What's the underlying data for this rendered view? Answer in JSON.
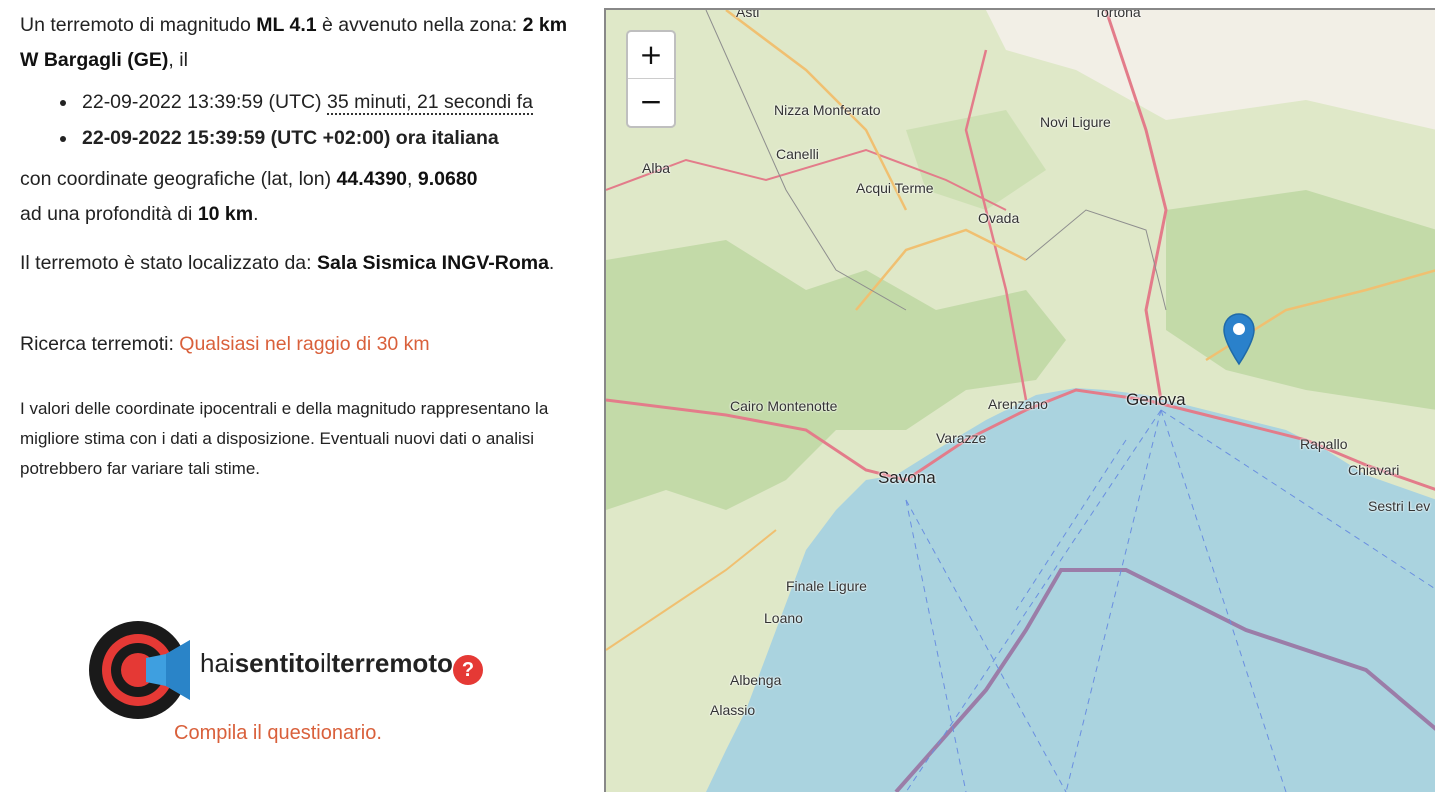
{
  "info": {
    "line1_pre": "Un terremoto di magnitudo ",
    "magnitude": "ML 4.1",
    "line1_post": " è avvenuto nella zona: ",
    "zone": "2 km W Bargagli (GE)",
    "line1_end": ", il",
    "utc_time": "22-09-2022 13:39:59 (UTC)",
    "ago": "35 minuti, 21 secondi fa",
    "local_time": "22-09-2022 15:39:59 (UTC +02:00) ora italiana",
    "coord_pre": "con coordinate geografiche (lat, lon) ",
    "lat": "44.4390",
    "coord_sep": ", ",
    "lon": "9.0680",
    "depth_pre": "ad una profondità di ",
    "depth": "10 km",
    "depth_post": ".",
    "located_pre": "Il terremoto è stato localizzato da: ",
    "located_by": "Sala Sismica INGV-Roma",
    "located_post": "."
  },
  "search": {
    "label": "Ricerca terremoti: ",
    "link": "Qualsiasi nel raggio di 30 km"
  },
  "disclaimer": "I valori delle coordinate ipocentrali e della magnitudo rappresentano la migliore stima con i dati a disposizione. Eventuali nuovi dati o analisi potrebbero far variare tali stime.",
  "survey": {
    "logo_hai": "hai",
    "logo_sentito": "sentito",
    "logo_il": "il",
    "logo_terremoto": "terremoto",
    "help_glyph": "?",
    "link": "Compila il questionario."
  },
  "map": {
    "zoom_in": "+",
    "zoom_out": "−",
    "labels": {
      "tortona": "Tortona",
      "asti": "Asti",
      "nizza": "Nizza Monferrato",
      "novi": "Novi Ligure",
      "canelli": "Canelli",
      "alba": "Alba",
      "acqui": "Acqui Terme",
      "ovada": "Ovada",
      "cairo": "Cairo Montenotte",
      "arenzano": "Arenzano",
      "genova": "Genova",
      "varazze": "Varazze",
      "rapallo": "Rapallo",
      "chiavari": "Chiavari",
      "sestri": "Sestri Lev",
      "savona": "Savona",
      "finale": "Finale Ligure",
      "loano": "Loano",
      "albenga": "Albenga",
      "alassio": "Alassio"
    },
    "colors": {
      "sea": "#aad3df",
      "land": "#dde6c8",
      "forest": "#b6d29c",
      "marker": "#2a81cb"
    }
  }
}
